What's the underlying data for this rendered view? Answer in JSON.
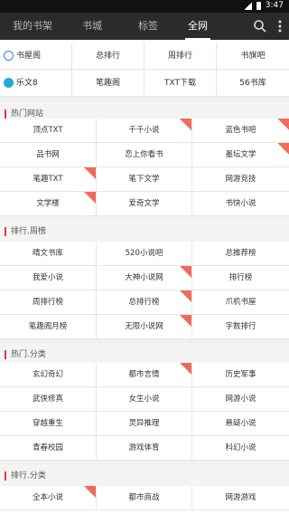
{
  "status": {
    "time": "3:47"
  },
  "tabs": [
    {
      "label": "我的书架",
      "active": false
    },
    {
      "label": "书城",
      "active": false
    },
    {
      "label": "标签",
      "active": false
    },
    {
      "label": "全网",
      "active": true
    }
  ],
  "quick_rows": [
    [
      "书屋阁",
      "总排行",
      "周排行",
      "书旗吧"
    ],
    [
      "乐文8",
      "笔趣阁",
      "TXT下载",
      "56书库"
    ]
  ],
  "sections": [
    {
      "title": "热门网站",
      "items": [
        {
          "label": "顶点TXT",
          "badge": false
        },
        {
          "label": "千千小说",
          "badge": true
        },
        {
          "label": "蓝色书吧",
          "badge": true
        },
        {
          "label": "品书网",
          "badge": false
        },
        {
          "label": "恋上你看书",
          "badge": false
        },
        {
          "label": "墨坛文学",
          "badge": true
        },
        {
          "label": "笔趣TXT",
          "badge": true
        },
        {
          "label": "笔下文学",
          "badge": false
        },
        {
          "label": "网游竞技",
          "badge": false
        },
        {
          "label": "文学楼",
          "badge": true
        },
        {
          "label": "爱奇文学",
          "badge": false
        },
        {
          "label": "书快小说",
          "badge": false
        }
      ]
    },
    {
      "title": "排行.周榜",
      "items": [
        {
          "label": "晴文书库",
          "badge": false
        },
        {
          "label": "520小说吧",
          "badge": false
        },
        {
          "label": "总推荐榜",
          "badge": false
        },
        {
          "label": "我爱小说",
          "badge": false
        },
        {
          "label": "大神小说网",
          "badge": true
        },
        {
          "label": "排行榜",
          "badge": false
        },
        {
          "label": "周排行榜",
          "badge": false
        },
        {
          "label": "总排行榜",
          "badge": true
        },
        {
          "label": "爪机书屋",
          "badge": false
        },
        {
          "label": "笔趣阁月榜",
          "badge": false
        },
        {
          "label": "无限小说网",
          "badge": true
        },
        {
          "label": "字数排行",
          "badge": false
        }
      ]
    },
    {
      "title": "热门.分类",
      "items": [
        {
          "label": "玄幻奇幻",
          "badge": false
        },
        {
          "label": "都市言情",
          "badge": true
        },
        {
          "label": "历史军事",
          "badge": false
        },
        {
          "label": "武侠修真",
          "badge": false
        },
        {
          "label": "女生小说",
          "badge": false
        },
        {
          "label": "网游小说",
          "badge": false
        },
        {
          "label": "穿越重生",
          "badge": false
        },
        {
          "label": "灵异推理",
          "badge": false
        },
        {
          "label": "悬疑小说",
          "badge": false
        },
        {
          "label": "青春校园",
          "badge": false
        },
        {
          "label": "游戏体育",
          "badge": false
        },
        {
          "label": "科幻小说",
          "badge": false
        }
      ]
    },
    {
      "title": "排行.分类",
      "items": [
        {
          "label": "全本小说",
          "badge": true
        },
        {
          "label": "都市商战",
          "badge": false
        },
        {
          "label": "网游游戏",
          "badge": false
        }
      ]
    }
  ],
  "colors": {
    "accent": "#e53935",
    "badge": "#ef6d57",
    "appbar": "#2b2b2b"
  },
  "icons": {
    "search": "search-icon",
    "more": "more-vert-icon"
  }
}
